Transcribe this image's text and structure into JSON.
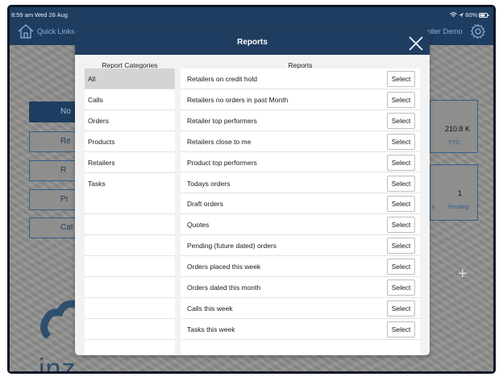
{
  "status_bar": {
    "time_date": "8:59 am  Wed 26 Aug",
    "battery": "60%"
  },
  "header": {
    "quick_links": "Quick Links",
    "demo_account": "plier Demo"
  },
  "background": {
    "buttons": [
      "No",
      "Re",
      "R",
      "Pr",
      "Cat"
    ],
    "cards": [
      {
        "value": "210.8 K",
        "label": "YTD"
      },
      {
        "value": "1",
        "label": "Pending",
        "partial_label": "s"
      }
    ],
    "logo_text": "inz"
  },
  "modal": {
    "title": "Reports",
    "categories_header": "Report Categories",
    "reports_header": "Reports",
    "categories": [
      {
        "label": "All",
        "active": true
      },
      {
        "label": "Calls"
      },
      {
        "label": "Orders"
      },
      {
        "label": "Products"
      },
      {
        "label": "Retailers"
      },
      {
        "label": "Tasks"
      },
      {
        "label": ""
      },
      {
        "label": ""
      },
      {
        "label": ""
      },
      {
        "label": ""
      },
      {
        "label": ""
      },
      {
        "label": ""
      },
      {
        "label": ""
      }
    ],
    "select_label": "Select",
    "reports": [
      "Retailers on credit hold",
      "Retailers no orders in past Month",
      "Retailer top performers",
      "Retailers close to me",
      "Product top performers",
      "Todays orders",
      "Draft orders",
      "Quotes",
      "Pending (future dated) orders",
      "Orders placed this week",
      "Orders dated this month",
      "Calls this week",
      "Tasks this week"
    ]
  },
  "colors": {
    "brand": "#1f3d60",
    "modal_bg": "#f2f2f2",
    "active_category": "#d4d4d4"
  }
}
